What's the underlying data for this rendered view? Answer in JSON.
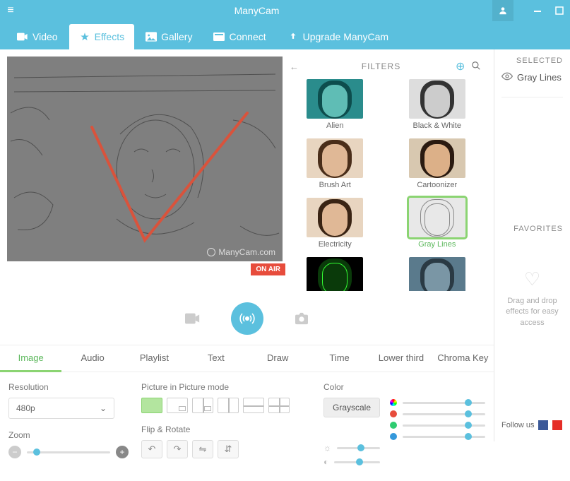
{
  "app": {
    "title": "ManyCam"
  },
  "nav": {
    "video": "Video",
    "effects": "Effects",
    "gallery": "Gallery",
    "connect": "Connect",
    "upgrade": "Upgrade ManyCam"
  },
  "preview": {
    "watermark": "ManyCam.com",
    "onair": "ON AIR"
  },
  "filters": {
    "title": "FILTERS",
    "items": [
      {
        "label": "Alien"
      },
      {
        "label": "Black & White"
      },
      {
        "label": "Brush Art"
      },
      {
        "label": "Cartoonizer"
      },
      {
        "label": "Electricity"
      },
      {
        "label": "Gray Lines",
        "selected": true
      },
      {
        "label": ""
      },
      {
        "label": ""
      }
    ]
  },
  "bottomTabs": {
    "image": "Image",
    "audio": "Audio",
    "playlist": "Playlist",
    "text": "Text",
    "draw": "Draw",
    "time": "Time",
    "lowerthird": "Lower third",
    "chromakey": "Chroma Key"
  },
  "settings": {
    "resolution_label": "Resolution",
    "resolution_value": "480p",
    "zoom_label": "Zoom",
    "pip_label": "Picture in Picture mode",
    "flip_label": "Flip & Rotate",
    "color_label": "Color",
    "color_mode": "Grayscale"
  },
  "right": {
    "selected_hdr": "SELECTED",
    "selected_item": "Gray Lines",
    "favorites_hdr": "FAVORITES",
    "dd_text": "Drag and drop effects for easy access",
    "follow": "Follow us"
  }
}
